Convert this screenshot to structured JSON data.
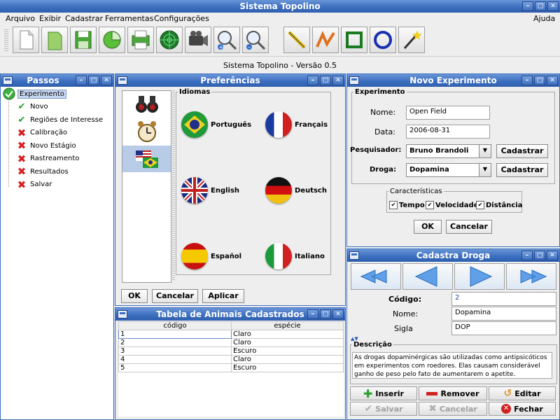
{
  "app": {
    "title": "Sistema Topolino",
    "subtitle": "Sistema Topolino - Versão 0.5"
  },
  "menu": {
    "arquivo": "Arquivo",
    "exibir": "Exibir",
    "cadastrar": "Cadastrar",
    "ferramentas": "Ferramentas",
    "configuracoes": "Configurações",
    "ajuda": "Ajuda"
  },
  "toolbar": {
    "icons": [
      "new-document-icon",
      "open-icon",
      "save-icon",
      "pie-chart-icon",
      "printer-icon",
      "radar-icon",
      "camera-icon",
      "zoom-in-icon",
      "zoom-out-icon",
      "line-tool-icon",
      "polyline-tool-icon",
      "rectangle-tool-icon",
      "circle-tool-icon",
      "magic-wand-icon"
    ]
  },
  "passos": {
    "title": "Passos",
    "root": "Experimento",
    "items": [
      {
        "label": "Novo",
        "status": "done"
      },
      {
        "label": "Regiões de Interesse",
        "status": "done"
      },
      {
        "label": "Calibração",
        "status": "pending"
      },
      {
        "label": "Novo Estágio",
        "status": "pending"
      },
      {
        "label": "Rastreamento",
        "status": "pending"
      },
      {
        "label": "Resultados",
        "status": "pending"
      },
      {
        "label": "Salvar",
        "status": "pending"
      }
    ]
  },
  "preferencias": {
    "title": "Preferências",
    "group": "Idiomas",
    "languages": [
      "Português",
      "Français",
      "English",
      "Deutsch",
      "Español",
      "Italiano"
    ],
    "ok": "OK",
    "cancel": "Cancelar",
    "apply": "Aplicar"
  },
  "tabela": {
    "title": "Tabela de Animais Cadastrados",
    "headers": [
      "código",
      "espécie"
    ],
    "rows": [
      [
        "1",
        "Claro"
      ],
      [
        "2",
        "Claro"
      ],
      [
        "3",
        "Escuro"
      ],
      [
        "4",
        "Claro"
      ],
      [
        "5",
        "Escuro"
      ]
    ]
  },
  "experimento": {
    "title": "Novo Experimento",
    "group": "Experimento",
    "nome_label": "Nome:",
    "nome": "Open Field",
    "data_label": "Data:",
    "data": "2006-08-31",
    "pesquisador_label": "Pesquisador:",
    "pesquisador": "Bruno Brandoli",
    "droga_label": "Droga:",
    "droga": "Dopamina",
    "cadastrar": "Cadastrar",
    "caracteristicas": "Características",
    "tempo": "Tempo",
    "velocidade": "Velocidade",
    "distancia": "Distância",
    "ok": "OK",
    "cancel": "Cancelar"
  },
  "droga": {
    "title": "Cadastra Droga",
    "codigo_label": "Código:",
    "codigo": "2",
    "nome_label": "Nome:",
    "nome": "Dopamina",
    "sigla_label": "Sigla",
    "sigla": "DOP",
    "descricao_label": "Descrição",
    "descricao": "As drogas dopaminérgicas são utilizadas como antipsicóticos em experimentos com roedores. Elas causam considerável ganho de peso pelo fato de aumentarem o apetite.",
    "inserir": "Inserir",
    "remover": "Remover",
    "editar": "Editar",
    "salvar": "Salvar",
    "cancelar": "Cancelar",
    "fechar": "Fechar"
  },
  "colors": {
    "titlebar": "#3d6fc0",
    "accent": "#2f5fae",
    "check": "#2ca02c",
    "cross": "#d62020"
  }
}
